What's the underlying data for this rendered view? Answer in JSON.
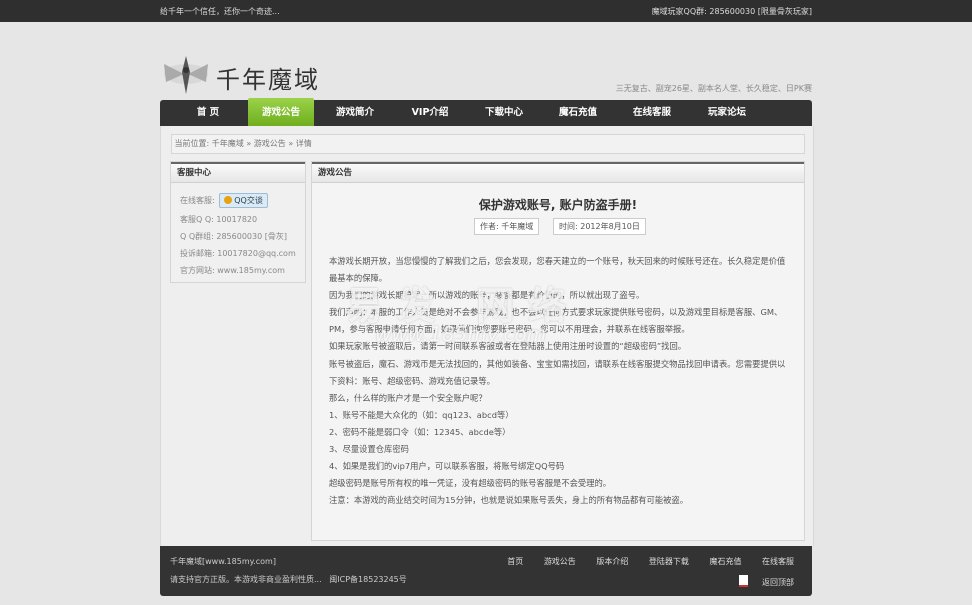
{
  "topbar": {
    "left": "给千年一个信任，还你一个奇迹...",
    "right": "魔域玩家QQ群: 285600030 [限量骨灰玩家]"
  },
  "logo": {
    "title": "千年魔域"
  },
  "slogan": "三无复古、副宠26星、副本名人堂、长久稳定、日PK赛",
  "nav": [
    "首 页",
    "游戏公告",
    "游戏简介",
    "VIP介绍",
    "下载中心",
    "魔石充值",
    "在线客服",
    "玩家论坛"
  ],
  "breadcrumb": {
    "prefix": "当前位置:",
    "items": [
      "千年魔域",
      "游戏公告",
      "详情"
    ],
    "sep": "»"
  },
  "sidebar": {
    "title": "客服中心",
    "online_label": "在线客服:",
    "qq_button": "QQ交谈",
    "rows": [
      "客服Q Q: 10017820",
      "Q Q群组: 285600030 [骨灰]",
      "投诉邮箱: 10017820@qq.com",
      "官方网站: www.185my.com"
    ]
  },
  "article": {
    "section": "游戏公告",
    "title": "保护游戏账号, 账户防盗手册!",
    "author": "作者: 千年魔域",
    "date": "时间: 2012年8月10日",
    "paragraphs": [
      "本游戏长期开放，当您慢慢的了解我们之后，您会发现，您春天建立的一个账号，秋天回来的时候账号还在。长久稳定是价值最基本的保障。",
      "因为我们的游戏长期稳定，所以游戏的账号，装备都是有价值的，所以就出现了盗号。",
      "我们声明：本服的工作人员是绝对不会参与游戏，也不会以任何方式要求玩家提供账号密码，以及游戏里目标是客服、GM、PM，参与客服申请任何方面，如果他们询您要账号密码，您可以不用理会，并联系在线客服举报。",
      "如果玩家账号被盗取后，请第一时间联系客服或者在登陆器上使用注册时设置的“超级密码”找回。",
      "账号被盗后，魔石、游戏币是无法找回的，其他如装备、宝宝如需找回，请联系在线客服提交物品找回申请表。您需要提供以下资料：账号、超级密码、游戏充值记录等。",
      "那么，什么样的账户才是一个安全账户呢？",
      "1、账号不能是大众化的（如：qq123、abcd等）",
      "2、密码不能是弱口令（如：12345、abcde等）",
      "3、尽量设置仓库密码",
      "4、如果是我们的vip7用户，可以联系客服，将账号绑定QQ号码",
      "超级密码是账号所有权的唯一凭证，没有超级密码的账号客服是不会受理的。",
      "注意：本游戏的商业结交时间为15分钟，也就是说如果账号丢失，身上的所有物品都有可能被盗。"
    ]
  },
  "watermark": {
    "main": "易发 网络",
    "sub": "www.185my.com"
  },
  "footer": {
    "site": "千年魔域[www.185my.com]",
    "notice": "请支持官方正版。本游戏非商业盈利性质...",
    "icp": "闽ICP备18523245号",
    "links": [
      "首页",
      "游戏公告",
      "版本介绍",
      "登陆器下载",
      "魔石充值",
      "在线客服"
    ],
    "back_top": "返回顶部"
  }
}
